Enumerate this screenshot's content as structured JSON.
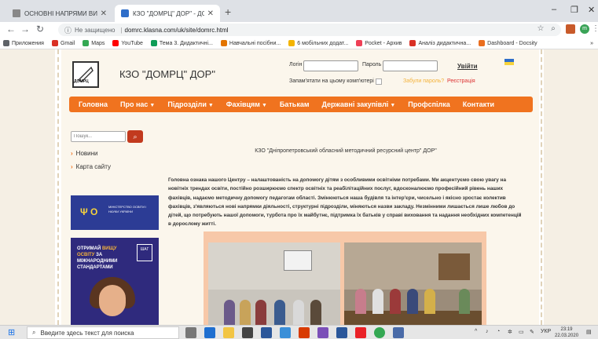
{
  "browser": {
    "tabs": [
      {
        "title": "ОСНОВНІ НАПРЯМИ ВИКОРИС",
        "active": false
      },
      {
        "title": "КЗО \"ДОМРЦ\" ДОР\" - ДОМПМ",
        "active": true
      }
    ],
    "new_tab_label": "+",
    "window_controls": {
      "minimize": "–",
      "maximize": "❐",
      "close": "✕"
    },
    "address": {
      "security_label": "Не защищено",
      "url": "domrc.klasna.com/uk/site/domrc.html"
    },
    "bookmarks": [
      {
        "label": "Приложения",
        "color": "#5f6368"
      },
      {
        "label": "Gmail",
        "color": "#d93025"
      },
      {
        "label": "Maps",
        "color": "#34a853"
      },
      {
        "label": "YouTube",
        "color": "#ff0000"
      },
      {
        "label": "Тема 3. Дидактичні...",
        "color": "#0f9d58"
      },
      {
        "label": "Навчальні посібни...",
        "color": "#e37400"
      },
      {
        "label": "6 мобільних додат...",
        "color": "#f4b400"
      },
      {
        "label": "Pocket - Архив",
        "color": "#ef4056"
      },
      {
        "label": "Аналіз дидактична...",
        "color": "#d93025"
      },
      {
        "label": "Dashboard - Docsity",
        "color": "#ea6e1f"
      }
    ],
    "bookmarks_more": "»"
  },
  "site": {
    "logo_text": "ДОМРЦ",
    "title": "КЗО \"ДОМРЦ\" ДОР\"",
    "login": {
      "login_label": "Логін",
      "password_label": "Пароль",
      "enter_label": "Увійти",
      "remember_label": "Запам'ятати на цьому комп'ютері",
      "forgot_label": "Забули пароль?",
      "register_label": "Реєстрація"
    },
    "menu": [
      {
        "label": "Головна",
        "dropdown": false
      },
      {
        "label": "Про нас",
        "dropdown": true
      },
      {
        "label": "Підрозділи",
        "dropdown": true
      },
      {
        "label": "Фахівцям",
        "dropdown": true
      },
      {
        "label": "Батькам",
        "dropdown": false
      },
      {
        "label": "Державні закупівлі",
        "dropdown": true
      },
      {
        "label": "Профспілка",
        "dropdown": false
      },
      {
        "label": "Контакти",
        "dropdown": false
      }
    ],
    "search_placeholder": "Пошук...",
    "side_links": [
      "Новини",
      "Карта сайту"
    ],
    "banner1_text": "МІНІСТЕРСТВО ОСВІТИ І НАУКИ УКРАЇНИ",
    "banner2": {
      "line1": "ОТРИМАЙ ",
      "highlight": "ВИЩУ ОСВІТУ",
      "line2": " ЗА МІЖНАРОДНИМИ СТАНДАРТАМИ",
      "badge": "ШАГ"
    },
    "center_title": "КЗО \"Дніпропетровський обласний методичний ресурсний центр\" ДОР\"",
    "body_text": "Головна ознака нашого Центру – налаштованість на допомогу дітям з особливими освітніми потребами. Ми акцентуємо свою увагу на новітніх трендах освіти, постійно розширюємо спектр освітніх та реабілітаційних послуг, вдосконалюємо професійний рівень наших фахівців, надаємо методичну допомогу педагогам області. Змінюються наша будівля та інтер'єри, чисельно і якісно зростає колектив фахівців, з'являються нові напрямки діяльності, структурні підрозділи, міняються назви закладу. Незмінними лишається лише любов до дітей, що потребують нашої допомоги, турбота про їх майбутнє, підтримка їх батьків у справі виховання та надання необхідних компетенцій в дорослому житті."
  },
  "taskbar": {
    "search_placeholder": "Введите здесь текст для поиска",
    "tray_lang": "УКР",
    "time": "23:19",
    "date": "22.03.2020"
  },
  "colors": {
    "menu_bg": "#f0731f",
    "search_btn": "#c23a1e",
    "banner1_bg": "#2c3c95",
    "banner2_bg": "#2f2a7d"
  }
}
